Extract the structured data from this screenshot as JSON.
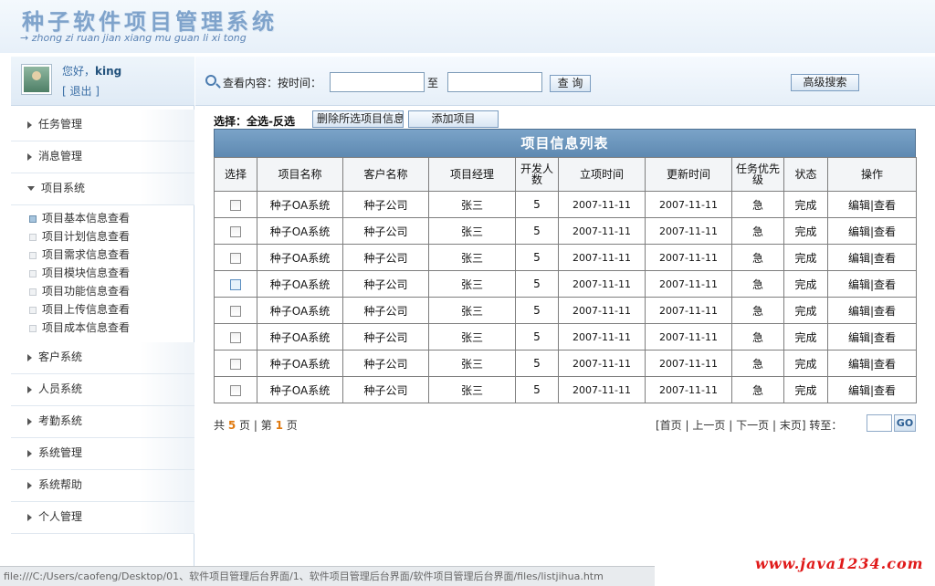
{
  "header": {
    "title": "种子软件项目管理系统",
    "subtitle": "→ zhong zi ruan jian xiang mu guan li xi tong"
  },
  "user": {
    "greeting": "您好，",
    "name": "king",
    "logout": "[ 退出 ]"
  },
  "sidebar": {
    "items": [
      {
        "label": "任务管理"
      },
      {
        "label": "消息管理"
      },
      {
        "label": "项目系统"
      },
      {
        "label": "客户系统"
      },
      {
        "label": "人员系统"
      },
      {
        "label": "考勤系统"
      },
      {
        "label": "系统管理"
      },
      {
        "label": "系统帮助"
      },
      {
        "label": "个人管理"
      }
    ],
    "subitems": [
      {
        "label": "项目基本信息查看"
      },
      {
        "label": "项目计划信息查看"
      },
      {
        "label": "项目需求信息查看"
      },
      {
        "label": "项目模块信息查看"
      },
      {
        "label": "项目功能信息查看"
      },
      {
        "label": "项目上传信息查看"
      },
      {
        "label": "项目成本信息查看"
      }
    ]
  },
  "search": {
    "label": "查看内容：按时间：",
    "from_value": "",
    "to_label": "至",
    "to_value": "",
    "query_button": "查 询",
    "advanced_button": "高级搜索"
  },
  "toolbar": {
    "select_label": "选择：全选-反选",
    "delete_button": "删除所选项目信息",
    "add_button": "添加项目"
  },
  "table": {
    "caption": "项目信息列表",
    "headers": [
      "选择",
      "项目名称",
      "客户名称",
      "项目经理",
      "开发人数",
      "立项时间",
      "更新时间",
      "任务优先级",
      "状态",
      "操作"
    ],
    "rows": [
      {
        "name": "种子OA系统",
        "client": "种子公司",
        "manager": "张三",
        "devs": "5",
        "start": "2007-11-11",
        "update": "2007-11-11",
        "priority": "急",
        "status": "完成",
        "edit": "编辑",
        "sep": "|",
        "view": "查看"
      },
      {
        "name": "种子OA系统",
        "client": "种子公司",
        "manager": "张三",
        "devs": "5",
        "start": "2007-11-11",
        "update": "2007-11-11",
        "priority": "急",
        "status": "完成",
        "edit": "编辑",
        "sep": "|",
        "view": "查看"
      },
      {
        "name": "种子OA系统",
        "client": "种子公司",
        "manager": "张三",
        "devs": "5",
        "start": "2007-11-11",
        "update": "2007-11-11",
        "priority": "急",
        "status": "完成",
        "edit": "编辑",
        "sep": "|",
        "view": "查看"
      },
      {
        "name": "种子OA系统",
        "client": "种子公司",
        "manager": "张三",
        "devs": "5",
        "start": "2007-11-11",
        "update": "2007-11-11",
        "priority": "急",
        "status": "完成",
        "edit": "编辑",
        "sep": "|",
        "view": "查看"
      },
      {
        "name": "种子OA系统",
        "client": "种子公司",
        "manager": "张三",
        "devs": "5",
        "start": "2007-11-11",
        "update": "2007-11-11",
        "priority": "急",
        "status": "完成",
        "edit": "编辑",
        "sep": "|",
        "view": "查看"
      },
      {
        "name": "种子OA系统",
        "client": "种子公司",
        "manager": "张三",
        "devs": "5",
        "start": "2007-11-11",
        "update": "2007-11-11",
        "priority": "急",
        "status": "完成",
        "edit": "编辑",
        "sep": "|",
        "view": "查看"
      },
      {
        "name": "种子OA系统",
        "client": "种子公司",
        "manager": "张三",
        "devs": "5",
        "start": "2007-11-11",
        "update": "2007-11-11",
        "priority": "急",
        "status": "完成",
        "edit": "编辑",
        "sep": "|",
        "view": "查看"
      },
      {
        "name": "种子OA系统",
        "client": "种子公司",
        "manager": "张三",
        "devs": "5",
        "start": "2007-11-11",
        "update": "2007-11-11",
        "priority": "急",
        "status": "完成",
        "edit": "编辑",
        "sep": "|",
        "view": "查看"
      }
    ]
  },
  "pager": {
    "total_prefix": "共",
    "total_pages": "5",
    "total_suffix": "页",
    "divider": "|",
    "current_prefix": "第",
    "current_page": "1",
    "current_suffix": "页",
    "first": "[首页",
    "prev": "上一页",
    "next": "下一页",
    "last": "末页]",
    "jump_label": "转至：",
    "jump_value": "",
    "go": "GO"
  },
  "statusbar": {
    "text": "file:///C:/Users/caofeng/Desktop/01、软件项目管理后台界面/1、软件项目管理后台界面/软件项目管理后台界面/files/listjihua.htm"
  },
  "watermark": "www.java1234.com",
  "colors": {
    "caption_bg": "#6b95bd",
    "accent": "#3a6ea5",
    "page_number": "#e07a10",
    "watermark": "#e01a1a"
  }
}
